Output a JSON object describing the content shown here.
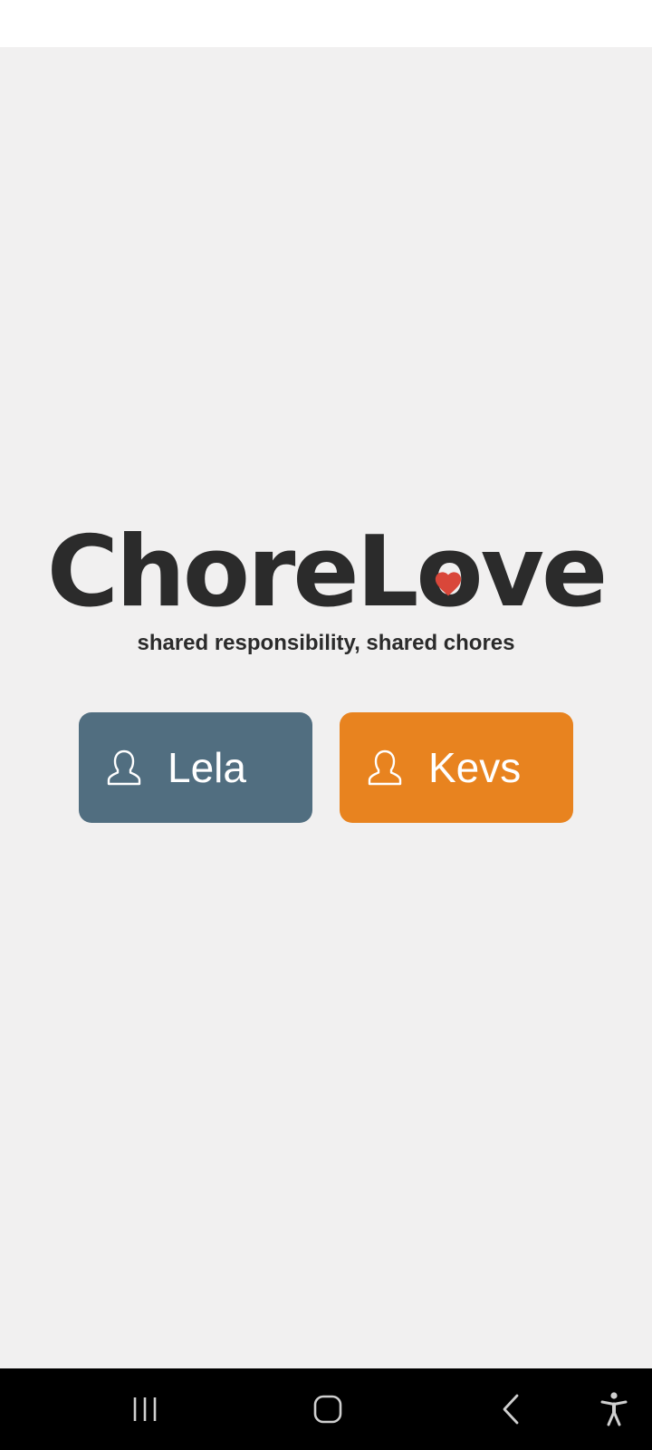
{
  "app": {
    "logo": {
      "part1": "Chore",
      "part2_before_heart": "L",
      "part2_heart_letter": "o",
      "part2_after_heart": "ve",
      "heart_color": "#d9473a",
      "text_color": "#2b2b2b"
    },
    "tagline": "shared responsibility, shared chores"
  },
  "users": [
    {
      "label": "Lela",
      "color": "#516e80",
      "icon": "user-icon"
    },
    {
      "label": "Kevs",
      "color": "#e8831f",
      "icon": "user-icon"
    }
  ],
  "colors": {
    "background": "#f1f0f0",
    "status_bar": "#ffffff",
    "nav_bar": "#000000"
  },
  "navigation_bar": {
    "buttons": [
      {
        "name": "recent-apps",
        "icon": "recent-apps-icon"
      },
      {
        "name": "home",
        "icon": "home-icon"
      },
      {
        "name": "back",
        "icon": "back-icon"
      },
      {
        "name": "accessibility",
        "icon": "accessibility-icon"
      }
    ]
  }
}
